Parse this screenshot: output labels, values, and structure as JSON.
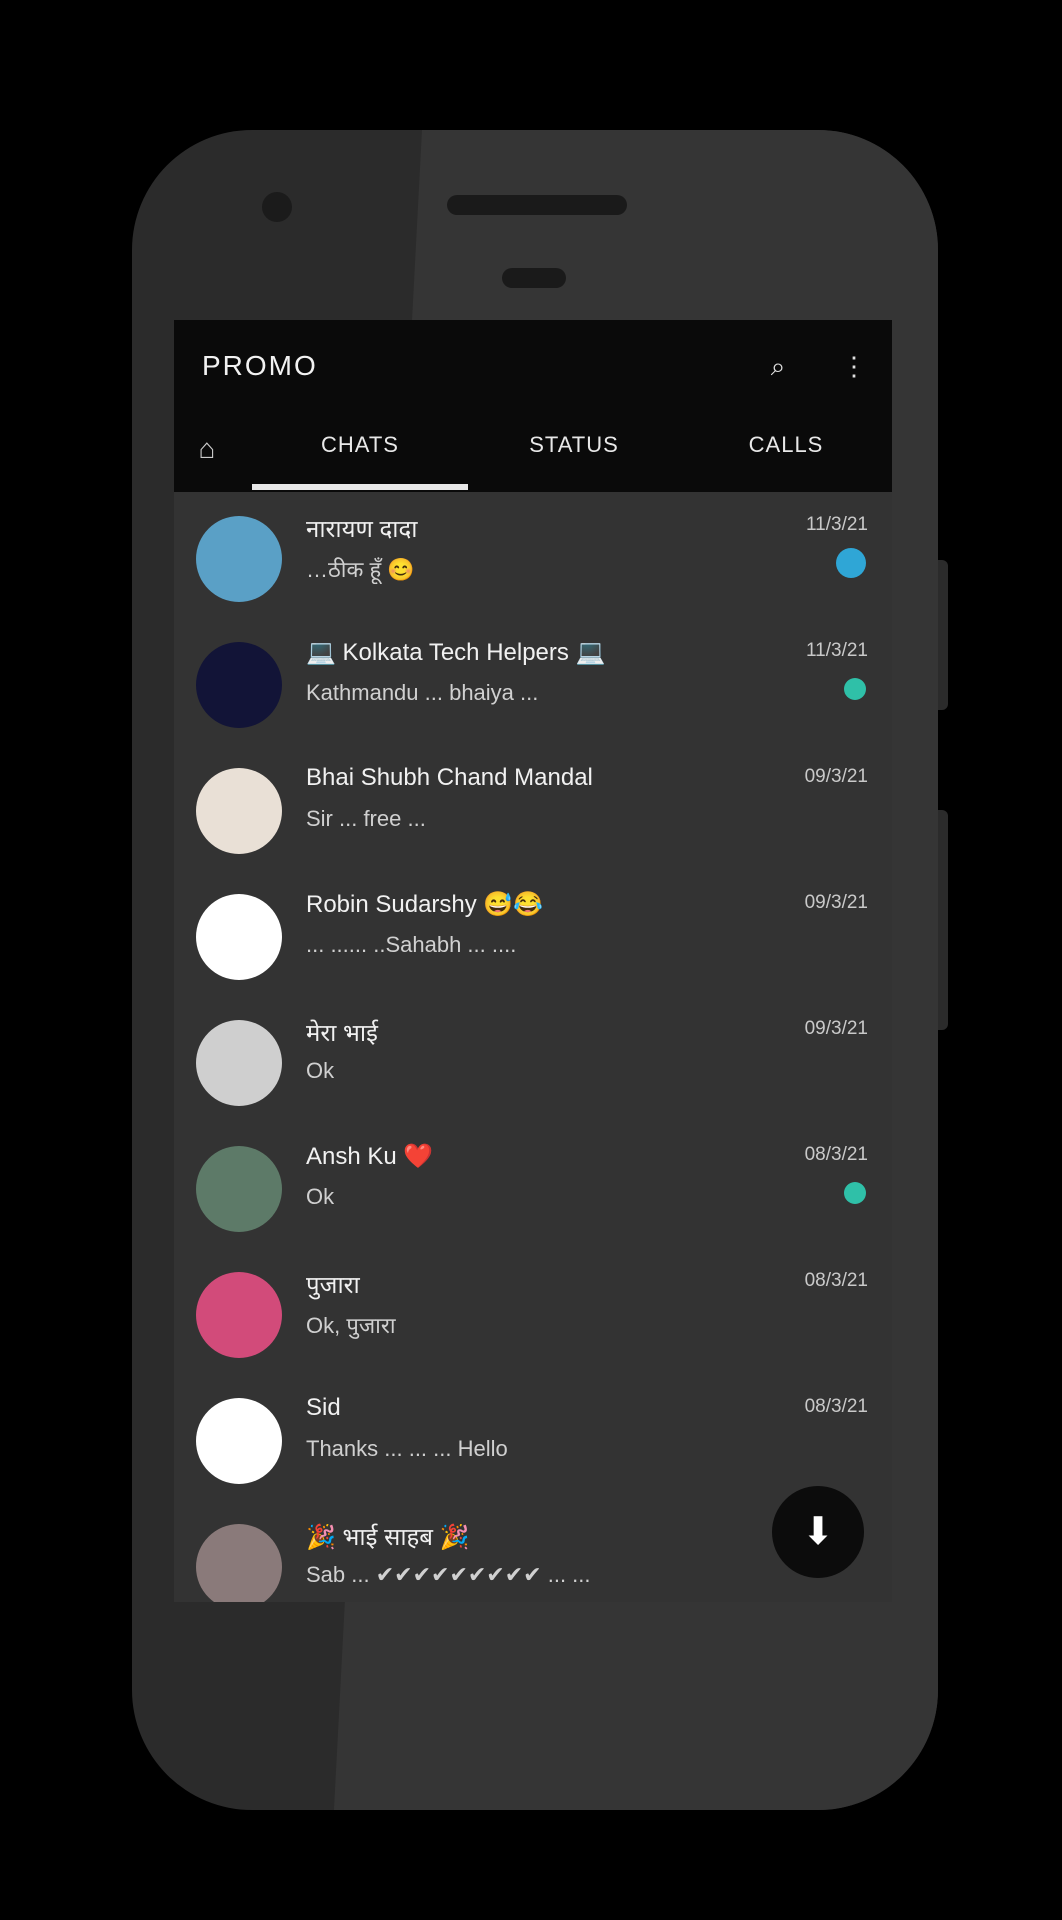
{
  "app": {
    "title": "PROMO"
  },
  "toolbar": {
    "search_icon": "search-icon",
    "menu_icon": "more-vert-icon"
  },
  "tabs": [
    {
      "label": "CHATS"
    },
    {
      "label": "STATUS"
    },
    {
      "label": "CALLS"
    }
  ],
  "chats": [
    {
      "name": "नारायण दादा",
      "message": "…ठीक हूँ 😊",
      "time": "11/3/21",
      "avatar_color": "#5aa0c6"
    },
    {
      "name": "💻 Kolkata Tech Helpers 💻",
      "message": "Kathmandu ... bhaiya ...",
      "time": "11/3/21",
      "avatar_color": "#121437"
    },
    {
      "name": "Bhai Shubh Chand Mandal",
      "message": "Sir ... free ...",
      "time": "09/3/21",
      "avatar_color": "#e9e0d6"
    },
    {
      "name": "Robin Sudarshy 😅😂",
      "message": "... ...... ..Sahabh ... ....",
      "time": "09/3/21",
      "avatar_color": "#ffffff"
    },
    {
      "name": "मेरा भाई",
      "message": "Ok",
      "time": "09/3/21",
      "avatar_color": "#cfcfcf"
    },
    {
      "name": "Ansh Ku ❤️",
      "message": "Ok",
      "time": "08/3/21",
      "avatar_color": "#5d7a68"
    },
    {
      "name": "पुजारा",
      "message": "Ok, पुजारा",
      "time": "08/3/21",
      "avatar_color": "#d24b7a"
    },
    {
      "name": "Sid",
      "message": "Thanks ... ... ... Hello",
      "time": "08/3/21",
      "avatar_color": "#ffffff"
    },
    {
      "name": "🎉 भाई साहब 🎉",
      "message": "Sab ... ✔✔✔✔✔✔✔✔✔ ... ...",
      "time": "",
      "avatar_color": "#8a7a7a"
    }
  ],
  "fab": {
    "icon": "down-arrow-icon"
  }
}
